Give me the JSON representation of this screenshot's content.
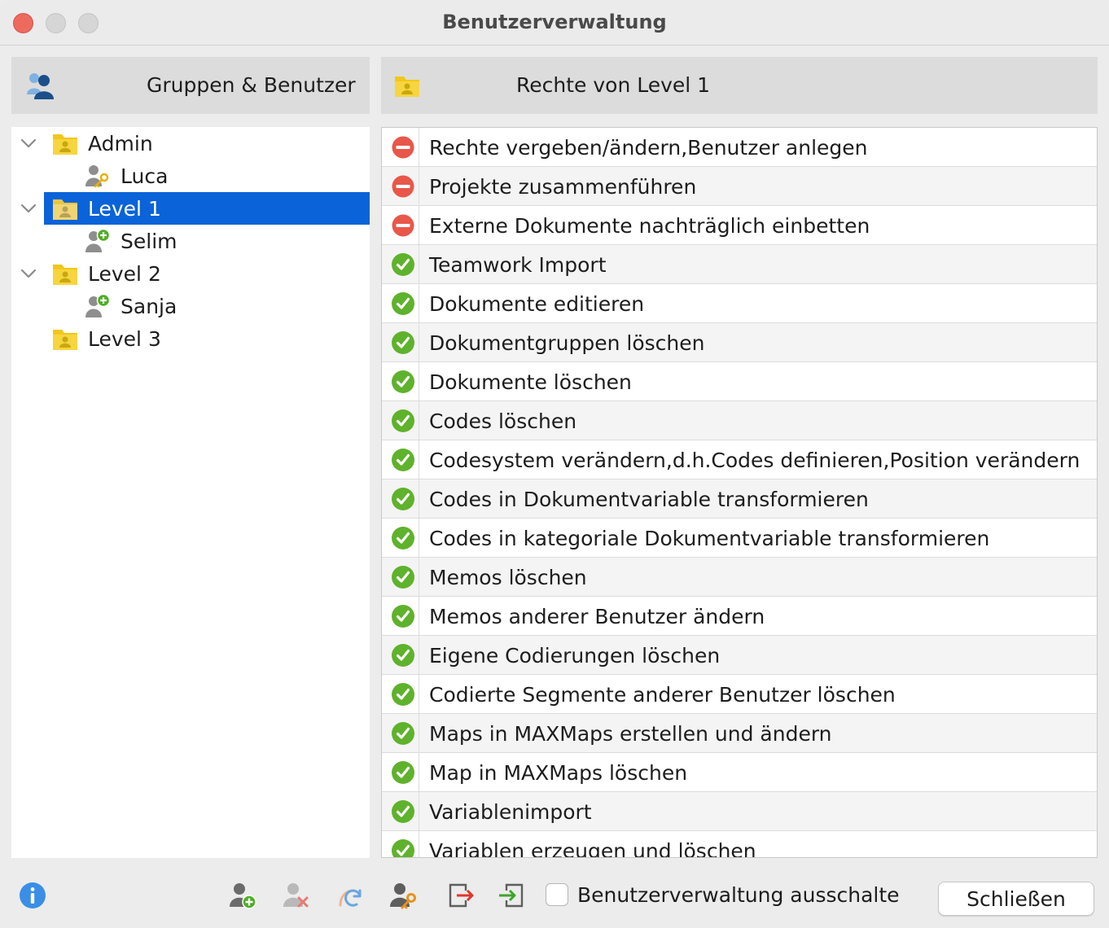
{
  "window": {
    "title": "Benutzerverwaltung"
  },
  "left_panel": {
    "header": "Gruppen & Benutzer",
    "header_icon": "users-icon",
    "tree": [
      {
        "label": "Admin",
        "type": "group",
        "expanded": true,
        "selected": false
      },
      {
        "label": "Luca",
        "type": "user",
        "badge": "key",
        "selected": false
      },
      {
        "label": "Level 1",
        "type": "group",
        "expanded": true,
        "selected": true
      },
      {
        "label": "Selim",
        "type": "user",
        "badge": "plus",
        "selected": false
      },
      {
        "label": "Level 2",
        "type": "group",
        "expanded": true,
        "selected": false
      },
      {
        "label": "Sanja",
        "type": "user",
        "badge": "plus",
        "selected": false
      },
      {
        "label": "Level 3",
        "type": "group",
        "expanded": false,
        "selected": false
      }
    ]
  },
  "right_panel": {
    "header": "Rechte von Level 1",
    "header_icon": "group-folder-icon",
    "rights": [
      {
        "label": "Rechte vergeben/ändern,Benutzer anlegen",
        "status": "denied"
      },
      {
        "label": "Projekte zusammenführen",
        "status": "denied"
      },
      {
        "label": "Externe Dokumente nachträglich einbetten",
        "status": "denied"
      },
      {
        "label": "Teamwork Import",
        "status": "allowed"
      },
      {
        "label": "Dokumente editieren",
        "status": "allowed"
      },
      {
        "label": "Dokumentgruppen löschen",
        "status": "allowed"
      },
      {
        "label": "Dokumente löschen",
        "status": "allowed"
      },
      {
        "label": "Codes löschen",
        "status": "allowed"
      },
      {
        "label": "Codesystem verändern,d.h.Codes definieren,Position verändern",
        "status": "allowed"
      },
      {
        "label": "Codes in Dokumentvariable transformieren",
        "status": "allowed"
      },
      {
        "label": "Codes in kategoriale Dokumentvariable transformieren",
        "status": "allowed"
      },
      {
        "label": "Memos löschen",
        "status": "allowed"
      },
      {
        "label": "Memos anderer Benutzer ändern",
        "status": "allowed"
      },
      {
        "label": "Eigene Codierungen löschen",
        "status": "allowed"
      },
      {
        "label": "Codierte Segmente anderer Benutzer löschen",
        "status": "allowed"
      },
      {
        "label": "Maps in MAXMaps erstellen und ändern",
        "status": "allowed"
      },
      {
        "label": "Map in MAXMaps löschen",
        "status": "allowed"
      },
      {
        "label": "Variablenimport",
        "status": "allowed"
      },
      {
        "label": "Variablen erzeugen und löschen",
        "status": "allowed"
      }
    ]
  },
  "footer": {
    "toolbar_icons": [
      "info-icon",
      "add-user-icon",
      "remove-user-icon",
      "refresh-user-icon",
      "user-key-icon",
      "export-icon",
      "import-icon"
    ],
    "checkbox_label": "Benutzerverwaltung ausschalte",
    "checkbox_checked": false,
    "close_label": "Schließen"
  },
  "colors": {
    "selection": "#0a63d8",
    "allowed": "#5fb22c",
    "denied": "#e8574a",
    "folder": "#f2c718"
  }
}
